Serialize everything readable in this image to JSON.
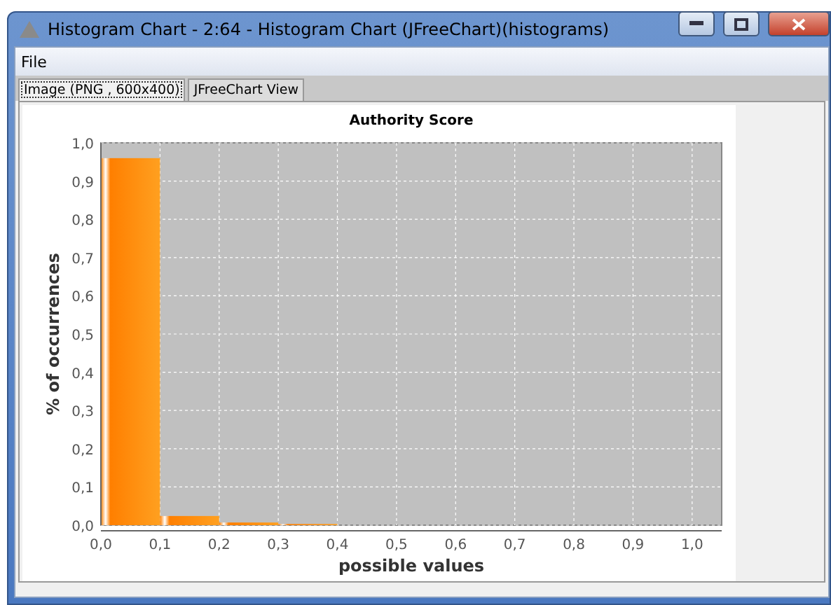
{
  "window": {
    "title": "Histogram Chart - 2:64 - Histogram Chart (JFreeChart)(histograms)"
  },
  "menu": [
    "File"
  ],
  "tabs": [
    {
      "label": "Image (PNG , 600x400)",
      "selected": true
    },
    {
      "label": "JFreeChart View",
      "selected": false
    }
  ],
  "chart": {
    "chart_data": {
      "type": "bar",
      "title": "Authority Score",
      "xlabel": "possible values",
      "ylabel": "% of occurrences",
      "x": [
        0.05,
        0.15,
        0.25,
        0.35
      ],
      "grid": true,
      "series": [
        {
          "color": "#ff7f00",
          "values": [
            0.96,
            0.024,
            0.007,
            0.003
          ]
        }
      ],
      "xlim": [
        0,
        1.05
      ],
      "ylim": [
        0,
        1.0
      ],
      "xticks": [
        {
          "value": 0,
          "label": "0,0"
        },
        {
          "value": 0.1,
          "label": "0,1"
        },
        {
          "value": 0.2,
          "label": "0,2"
        },
        {
          "value": 0.3,
          "label": "0,3"
        },
        {
          "value": 0.4,
          "label": "0,4"
        },
        {
          "value": 0.5,
          "label": "0,5"
        },
        {
          "value": 0.6,
          "label": "0,6"
        },
        {
          "value": 0.7,
          "label": "0,7"
        },
        {
          "value": 0.8,
          "label": "0,8"
        },
        {
          "value": 0.9,
          "label": "0,9"
        },
        {
          "value": 1.0,
          "label": "1,0"
        }
      ],
      "yticks": [
        {
          "value": 0,
          "label": "0,0"
        },
        {
          "value": 0.1,
          "label": "0,1"
        },
        {
          "value": 0.2,
          "label": "0,2"
        },
        {
          "value": 0.3,
          "label": "0,3"
        },
        {
          "value": 0.4,
          "label": "0,4"
        },
        {
          "value": 0.5,
          "label": "0,5"
        },
        {
          "value": 0.6,
          "label": "0,6"
        },
        {
          "value": 0.7,
          "label": "0,7"
        },
        {
          "value": 0.8,
          "label": "0,8"
        },
        {
          "value": 0.9,
          "label": "0,9"
        },
        {
          "value": 1.0,
          "label": "1,0"
        }
      ]
    }
  }
}
